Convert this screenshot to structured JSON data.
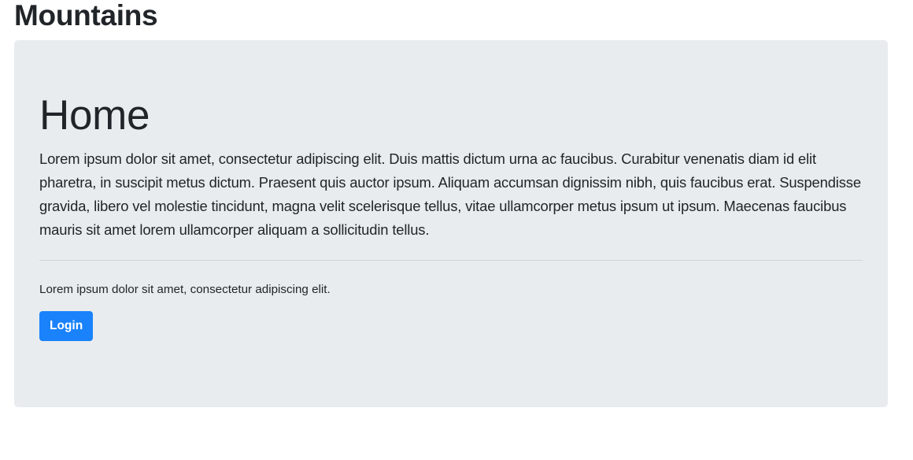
{
  "header": {
    "title": "Mountains"
  },
  "jumbotron": {
    "heading": "Home",
    "lead": "Lorem ipsum dolor sit amet, consectetur adipiscing elit. Duis mattis dictum urna ac faucibus. Curabitur venenatis diam id elit pharetra, in suscipit metus dictum. Praesent quis auctor ipsum. Aliquam accumsan dignissim nibh, quis faucibus erat. Suspendisse gravida, libero vel molestie tincidunt, magna velit scelerisque tellus, vitae ullamcorper metus ipsum ut ipsum. Maecenas faucibus mauris sit amet lorem ullamcorper aliquam a sollicitudin tellus.",
    "sub_text": "Lorem ipsum dolor sit amet, consectetur adipiscing elit.",
    "login_label": "Login"
  },
  "colors": {
    "jumbotron_bg": "#e9ecef",
    "primary": "#1a82fb",
    "text": "#212529"
  }
}
